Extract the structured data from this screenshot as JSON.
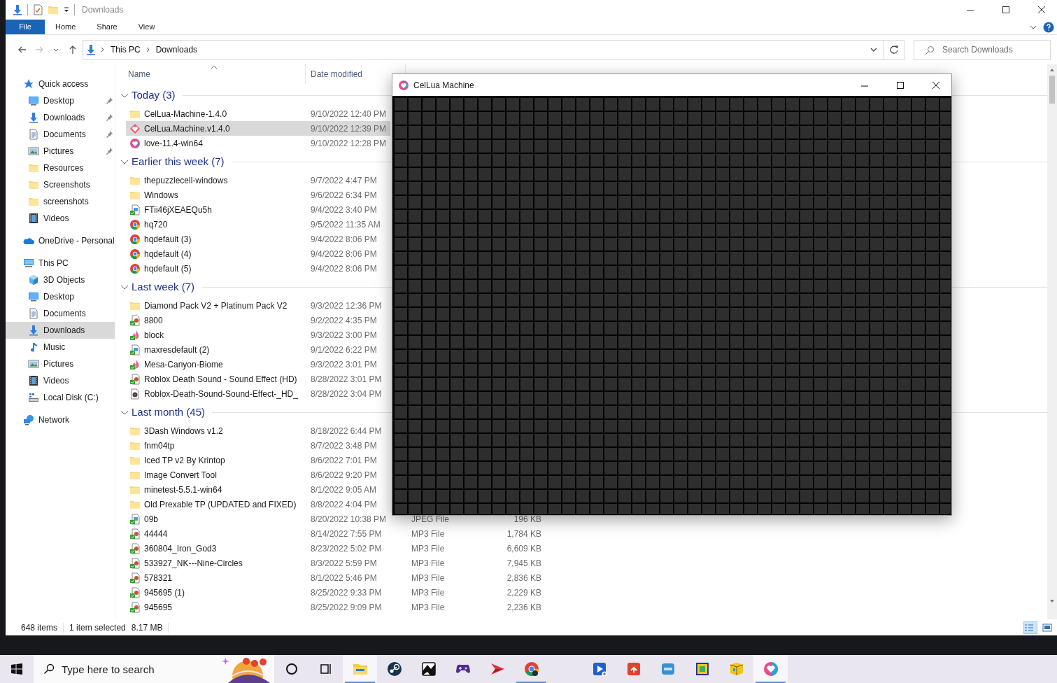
{
  "title_bar": {
    "title": "Downloads"
  },
  "ribbon_tabs": [
    {
      "label": "File",
      "kind": "file"
    },
    {
      "label": "Home",
      "kind": "tab"
    },
    {
      "label": "Share",
      "kind": "tab"
    },
    {
      "label": "View",
      "kind": "tab"
    }
  ],
  "nav_buttons": [
    {
      "kind": "back",
      "disabled": false
    },
    {
      "kind": "forward",
      "disabled": true
    },
    {
      "kind": "recent",
      "disabled": false
    },
    {
      "kind": "up",
      "disabled": false
    }
  ],
  "address": {
    "path": [
      "This PC",
      "Downloads"
    ]
  },
  "search": {
    "placeholder": "Search Downloads"
  },
  "sidebar": [
    {
      "label": "Quick access",
      "kind": "star",
      "selected": false,
      "children": [
        {
          "label": "Desktop",
          "kind": "desktop",
          "pinned": true,
          "selected": false
        },
        {
          "label": "Downloads",
          "kind": "download",
          "pinned": true,
          "selected": false
        },
        {
          "label": "Documents",
          "kind": "document",
          "pinned": true,
          "selected": false
        },
        {
          "label": "Pictures",
          "kind": "pictures",
          "pinned": true,
          "selected": false
        },
        {
          "label": "Resources",
          "kind": "folder",
          "pinned": false,
          "selected": false
        },
        {
          "label": "Screenshots",
          "kind": "folder",
          "pinned": false,
          "selected": false
        },
        {
          "label": "screenshots",
          "kind": "folder",
          "pinned": false,
          "selected": false
        },
        {
          "label": "Videos",
          "kind": "videos",
          "pinned": false,
          "selected": false
        }
      ]
    },
    {
      "label": "OneDrive - Personal",
      "kind": "cloud",
      "selected": false
    },
    {
      "label": "This PC",
      "kind": "pc",
      "selected": false,
      "children": [
        {
          "label": "3D Objects",
          "kind": "cube",
          "selected": false
        },
        {
          "label": "Desktop",
          "kind": "desktop",
          "selected": false
        },
        {
          "label": "Documents",
          "kind": "document",
          "selected": false
        },
        {
          "label": "Downloads",
          "kind": "download",
          "selected": true
        },
        {
          "label": "Music",
          "kind": "music",
          "selected": false
        },
        {
          "label": "Pictures",
          "kind": "pictures",
          "selected": false
        },
        {
          "label": "Videos",
          "kind": "videos",
          "selected": false
        },
        {
          "label": "Local Disk (C:)",
          "kind": "disk",
          "selected": false
        }
      ]
    },
    {
      "label": "Network",
      "kind": "network",
      "selected": false
    }
  ],
  "columns": [
    {
      "label": "Name",
      "sorted": true
    },
    {
      "label": "Date modified",
      "sorted": false
    }
  ],
  "groups": [
    {
      "label": "Today (3)",
      "expanded": true,
      "rows": [
        {
          "name": "CelLua-Machine-1.4.0",
          "kind": "folder",
          "date": "9/10/2022 12:40 PM",
          "selected": false
        },
        {
          "name": "CelLua.Machine.v1.4.0",
          "kind": "app",
          "date": "9/10/2022 12:39 PM",
          "selected": true
        },
        {
          "name": "love-11.4-win64",
          "kind": "love",
          "date": "9/10/2022 12:28 PM",
          "selected": false
        }
      ]
    },
    {
      "label": "Earlier this week (7)",
      "expanded": true,
      "rows": [
        {
          "name": "thepuzzlecell-windows",
          "kind": "folder",
          "date": "9/7/2022 4:47 PM",
          "selected": false
        },
        {
          "name": "Windows",
          "kind": "folder",
          "date": "9/6/2022 6:34 PM",
          "selected": false
        },
        {
          "name": "FTii46jXEAEQu5h",
          "kind": "image",
          "date": "9/4/2022 3:40 PM",
          "selected": false
        },
        {
          "name": "hq720",
          "kind": "browser",
          "date": "9/5/2022 11:35 AM",
          "selected": false
        },
        {
          "name": "hqdefault (3)",
          "kind": "browser",
          "date": "9/4/2022 8:06 PM",
          "selected": false
        },
        {
          "name": "hqdefault (4)",
          "kind": "browser",
          "date": "9/4/2022 8:06 PM",
          "selected": false
        },
        {
          "name": "hqdefault (5)",
          "kind": "browser",
          "date": "9/4/2022 8:06 PM",
          "selected": false
        }
      ]
    },
    {
      "label": "Last week (7)",
      "expanded": true,
      "rows": [
        {
          "name": "Diamond Pack V2 + Platinum Pack V2",
          "kind": "folder",
          "date": "9/3/2022 12:36 PM",
          "selected": false
        },
        {
          "name": "8800",
          "kind": "audio",
          "date": "9/2/2022 4:35 PM",
          "selected": false
        },
        {
          "name": "block",
          "kind": "flame",
          "date": "9/3/2022 3:00 PM",
          "selected": false
        },
        {
          "name": "maxresdefault (2)",
          "kind": "image",
          "date": "9/1/2022 6:22 PM",
          "selected": false
        },
        {
          "name": "Mesa-Canyon-Biome",
          "kind": "flame",
          "date": "9/3/2022 3:01 PM",
          "selected": false
        },
        {
          "name": "Roblox Death Sound - Sound Effect (HD)",
          "kind": "audio",
          "date": "8/28/2022 3:01 PM",
          "selected": false
        },
        {
          "name": "Roblox-Death-Sound-Sound-Effect-_HD_",
          "kind": "disc",
          "date": "8/28/2022 3:04 PM",
          "selected": false
        }
      ]
    },
    {
      "label": "Last month (45)",
      "expanded": true,
      "rows": [
        {
          "name": "3Dash Windows v1.2",
          "kind": "folder",
          "date": "8/18/2022 6:44 PM",
          "selected": false
        },
        {
          "name": "fnm04tp",
          "kind": "folder",
          "date": "8/7/2022 3:48 PM",
          "selected": false
        },
        {
          "name": "Iced TP v2 By Krintop",
          "kind": "folder",
          "date": "8/6/2022 7:01 PM",
          "selected": false
        },
        {
          "name": "Image Convert Tool",
          "kind": "folder",
          "date": "8/6/2022 9:20 PM",
          "selected": false
        },
        {
          "name": "minetest-5.5.1-win64",
          "kind": "folder",
          "date": "8/1/2022 9:05 AM",
          "selected": false
        },
        {
          "name": "Old Prexable TP (UPDATED and FIXED)",
          "kind": "folder",
          "date": "8/8/2022 4:04 PM",
          "selected": false
        },
        {
          "name": "09b",
          "kind": "image",
          "date": "8/20/2022 10:38 PM",
          "type": "JPEG File",
          "size": "196 KB",
          "selected": false
        },
        {
          "name": "44444",
          "kind": "audio",
          "date": "8/14/2022 7:55 PM",
          "type": "MP3 File",
          "size": "1,784 KB",
          "selected": false
        },
        {
          "name": "360804_Iron_God3",
          "kind": "audio",
          "date": "8/23/2022 5:02 PM",
          "type": "MP3 File",
          "size": "6,609 KB",
          "selected": false
        },
        {
          "name": "533927_NK---Nine-Circles",
          "kind": "audio",
          "date": "8/3/2022 5:59 PM",
          "type": "MP3 File",
          "size": "7,945 KB",
          "selected": false
        },
        {
          "name": "578321",
          "kind": "audio",
          "date": "8/1/2022 5:46 PM",
          "type": "MP3 File",
          "size": "2,836 KB",
          "selected": false
        },
        {
          "name": "945695 (1)",
          "kind": "audio",
          "date": "8/25/2022 9:33 PM",
          "type": "MP3 File",
          "size": "2,229 KB",
          "selected": false
        },
        {
          "name": "945695",
          "kind": "audio",
          "date": "8/25/2022 9:09 PM",
          "type": "MP3 File",
          "size": "2,236 KB",
          "selected": false
        }
      ]
    }
  ],
  "status_bar": {
    "items": "648 items",
    "selection": "1 item selected",
    "size": "8.17 MB"
  },
  "app_window": {
    "title": "CelLua Machine"
  },
  "taskbar": {
    "search_placeholder": "Type here to search",
    "apps": [
      {
        "kind": "cortana",
        "running": false,
        "active": false
      },
      {
        "kind": "taskview",
        "running": false,
        "active": false
      },
      {
        "kind": "explorer",
        "running": true,
        "active": true
      },
      {
        "kind": "steam",
        "running": false,
        "active": false
      },
      {
        "kind": "cutout",
        "running": false,
        "active": false
      },
      {
        "kind": "controller",
        "running": false,
        "active": false
      },
      {
        "kind": "arrow",
        "running": false,
        "active": false
      },
      {
        "kind": "browser",
        "running": true,
        "active": false
      }
    ],
    "apps_2": [
      {
        "kind": "video",
        "running": false,
        "active": false
      },
      {
        "kind": "puzzle",
        "running": false,
        "active": false
      },
      {
        "kind": "tpc",
        "running": false,
        "active": false
      },
      {
        "kind": "dash",
        "running": false,
        "active": false
      },
      {
        "kind": "box",
        "running": false,
        "active": false
      },
      {
        "kind": "heart",
        "running": true,
        "active": true
      }
    ]
  }
}
